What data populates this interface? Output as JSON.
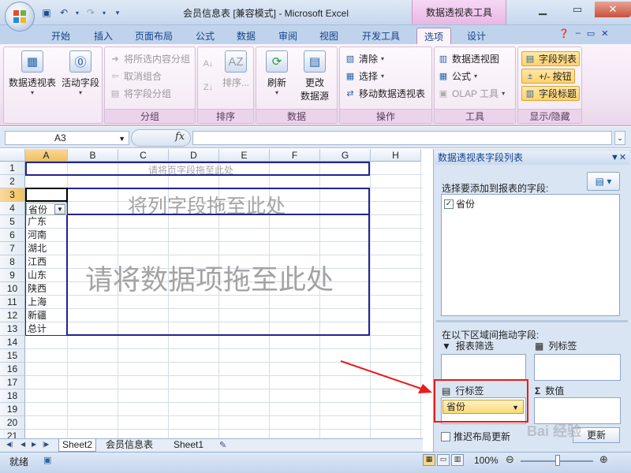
{
  "window": {
    "title": "会员信息表  [兼容模式] - Microsoft Excel",
    "context_tab_title": "数据透视表工具"
  },
  "ribbon_tabs": [
    "开始",
    "插入",
    "页面布局",
    "公式",
    "数据",
    "审阅",
    "视图",
    "开发工具",
    "选项",
    "设计"
  ],
  "active_tab": "选项",
  "ribbon": {
    "pivot_table": {
      "label": "数据透视表"
    },
    "active_field": {
      "label": "活动字段"
    },
    "group": {
      "title": "分组",
      "group_selection": "将所选内容分组",
      "ungroup": "取消组合",
      "group_field": "将字段分组"
    },
    "sort": {
      "title": "排序",
      "sort_label": "排序..."
    },
    "data": {
      "title": "数据",
      "refresh": "刷新",
      "change_source_1": "更改",
      "change_source_2": "数据源"
    },
    "actions": {
      "title": "操作",
      "clear": "清除",
      "select": "选择",
      "move": "移动数据透视表"
    },
    "tools": {
      "title": "工具",
      "pivot_chart": "数据透视图",
      "formulas": "公式",
      "olap": "OLAP 工具"
    },
    "show_hide": {
      "title": "显示/隐藏",
      "field_list": "字段列表",
      "buttons": "+/- 按钮",
      "headers": "字段标题"
    }
  },
  "formula_bar": {
    "name_box": "A3",
    "fx": "fx"
  },
  "sheet": {
    "columns": [
      "A",
      "B",
      "C",
      "D",
      "E",
      "F",
      "G",
      "H"
    ],
    "rows": [
      "1",
      "2",
      "3",
      "4",
      "5",
      "6",
      "7",
      "8",
      "9",
      "10",
      "11",
      "12",
      "13",
      "14",
      "15",
      "16",
      "17",
      "18",
      "19",
      "20",
      "21"
    ],
    "page_drop": "请将页字段拖至此处",
    "col_drop": "将列字段拖至此处",
    "data_drop": "请将数据项拖至此处",
    "row_header": "省份",
    "provinces": [
      "广东",
      "河南",
      "湖北",
      "江西",
      "山东",
      "陕西",
      "上海",
      "新疆"
    ],
    "total": "总计"
  },
  "sheet_tabs": [
    "Sheet2",
    "会员信息表",
    "Sheet1"
  ],
  "active_sheet": "Sheet2",
  "pane": {
    "title": "数据透视表字段列表",
    "choose_label": "选择要添加到报表的字段:",
    "fields": [
      {
        "name": "省份",
        "checked": true
      }
    ],
    "drag_label": "在以下区域间拖动字段:",
    "report_filter": "报表筛选",
    "column_labels": "列标签",
    "row_labels": "行标签",
    "values": "数值",
    "row_field": "省份",
    "defer_label": "推迟布局更新",
    "update_label": "更新"
  },
  "status": {
    "text": "就绪",
    "zoom": "100%"
  },
  "watermark": "Bai 经验"
}
